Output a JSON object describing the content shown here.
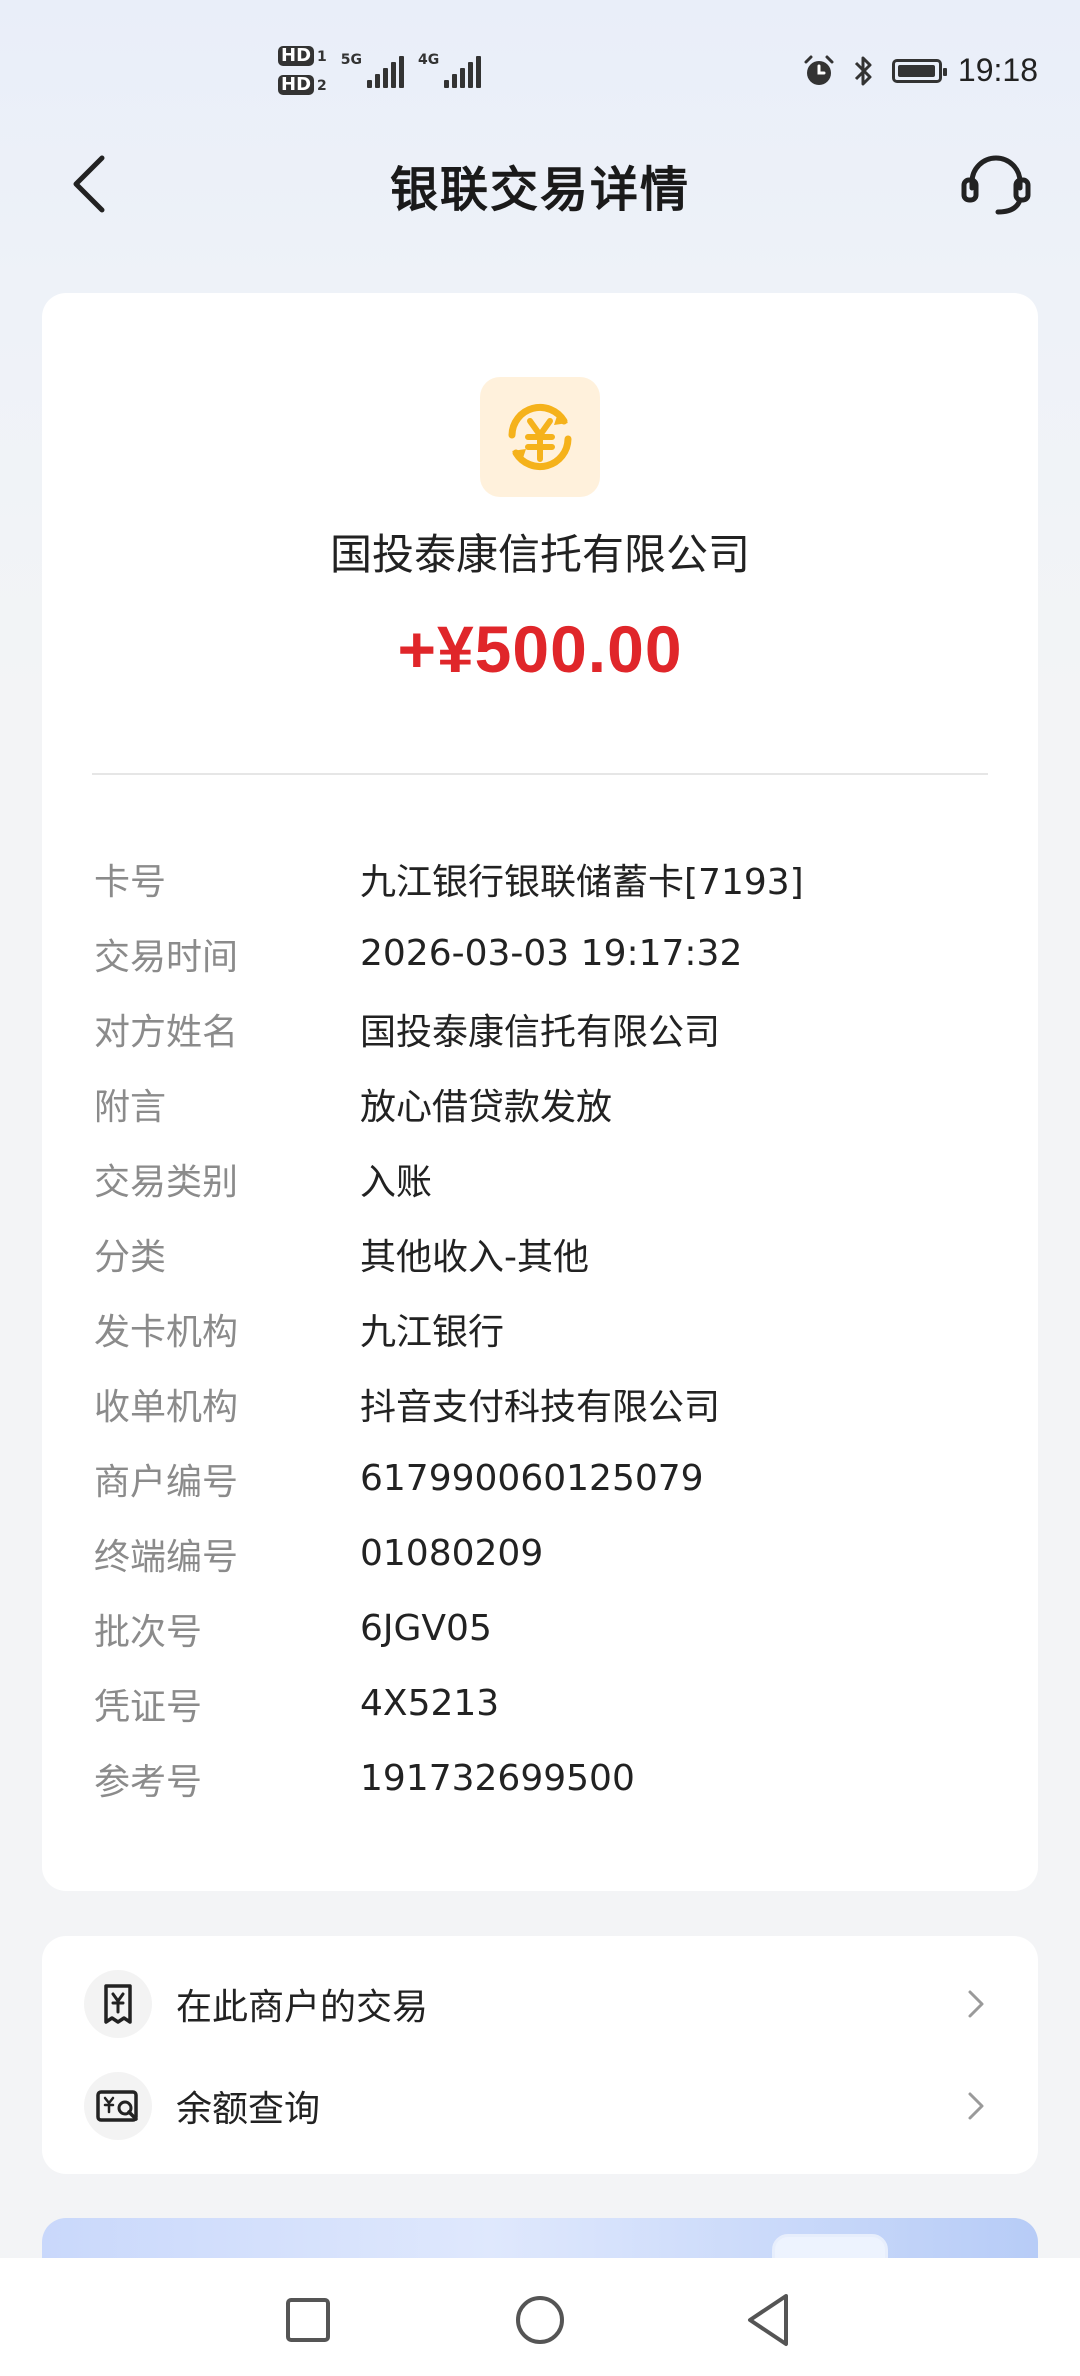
{
  "status_bar": {
    "hd1": "HD",
    "hd1_index": "1",
    "hd2": "HD",
    "hd2_index": "2",
    "network1": "5G",
    "network2": "4G",
    "time": "19:18"
  },
  "header": {
    "title": "银联交易详情"
  },
  "transaction": {
    "merchant_name": "国投泰康信托有限公司",
    "amount": "+¥500.00",
    "details": [
      {
        "label": "卡号",
        "value": "九江银行银联储蓄卡[7193]"
      },
      {
        "label": "交易时间",
        "value": "2026-03-03 19:17:32"
      },
      {
        "label": "对方姓名",
        "value": "国投泰康信托有限公司"
      },
      {
        "label": "附言",
        "value": "放心借贷款发放"
      },
      {
        "label": "交易类别",
        "value": "入账"
      },
      {
        "label": "分类",
        "value": "其他收入-其他"
      },
      {
        "label": "发卡机构",
        "value": "九江银行"
      },
      {
        "label": "收单机构",
        "value": "抖音支付科技有限公司"
      },
      {
        "label": "商户编号",
        "value": "617990060125079"
      },
      {
        "label": "终端编号",
        "value": "01080209"
      },
      {
        "label": "批次号",
        "value": "6JGV05"
      },
      {
        "label": "凭证号",
        "value": "4X5213"
      },
      {
        "label": "参考号",
        "value": "191732699500"
      }
    ]
  },
  "actions": [
    {
      "label": "在此商户的交易",
      "icon": "receipt-icon"
    },
    {
      "label": "余额查询",
      "icon": "balance-query-icon"
    }
  ],
  "colors": {
    "amount": "#e0262a",
    "logo_bg": "#fff1dc",
    "logo_fg": "#f5b21b"
  }
}
